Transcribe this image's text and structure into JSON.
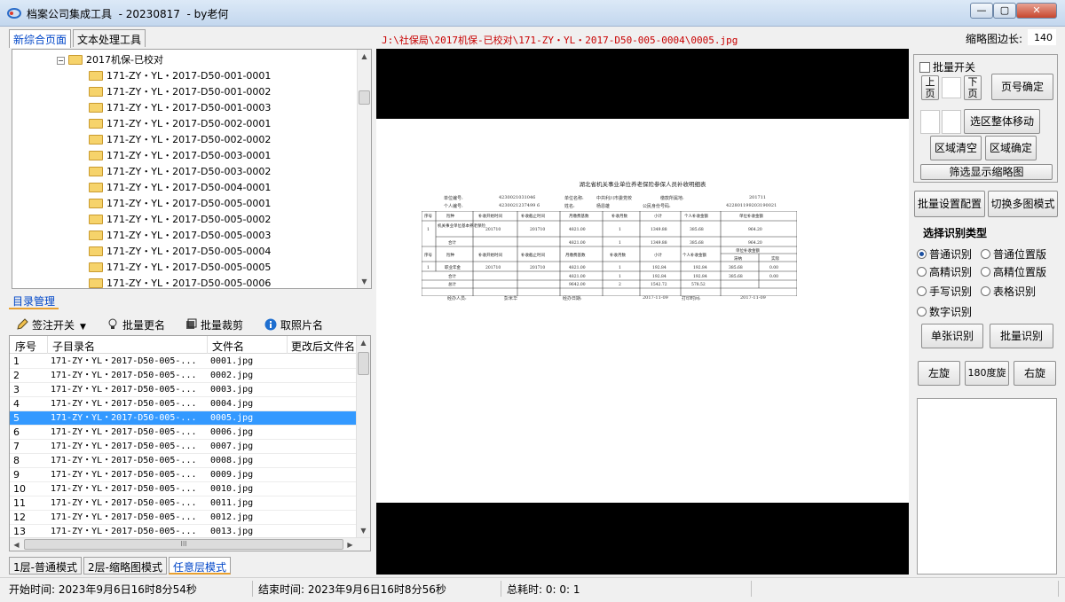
{
  "window": {
    "title": "档案公司集成工具  - 20230817  - by老何",
    "controls": {
      "minimize": "—",
      "maximize": "▢",
      "close": "✕"
    }
  },
  "tabs": [
    {
      "label": "新综合页面",
      "active": true
    },
    {
      "label": "文本处理工具",
      "active": false
    }
  ],
  "current_path": "J:\\社保局\\2017机保-已校对\\171-ZY・YL・2017-D50-005-0004\\0005.jpg",
  "thumbnail_edge": {
    "label": "缩略图边长:",
    "value": "140"
  },
  "tree": {
    "root": "2017机保-已校对",
    "items": [
      "171-ZY・YL・2017-D50-001-0001",
      "171-ZY・YL・2017-D50-001-0002",
      "171-ZY・YL・2017-D50-001-0003",
      "171-ZY・YL・2017-D50-002-0001",
      "171-ZY・YL・2017-D50-002-0002",
      "171-ZY・YL・2017-D50-003-0001",
      "171-ZY・YL・2017-D50-003-0002",
      "171-ZY・YL・2017-D50-004-0001",
      "171-ZY・YL・2017-D50-005-0001",
      "171-ZY・YL・2017-D50-005-0002",
      "171-ZY・YL・2017-D50-005-0003",
      "171-ZY・YL・2017-D50-005-0004",
      "171-ZY・YL・2017-D50-005-0005",
      "171-ZY・YL・2017-D50-005-0006"
    ]
  },
  "dir_mgmt_tab": "目录管理",
  "toolbar": {
    "annotate": "签注开关",
    "batch_rename": "批量更名",
    "batch_crop": "批量裁剪",
    "photo_name": "取照片名"
  },
  "grid": {
    "headers": [
      "序号",
      "子目录名",
      "文件名",
      "更改后文件名"
    ],
    "rows": [
      {
        "no": "1",
        "sub": "171-ZY・YL・2017-D50-005-...",
        "file": "0001.jpg"
      },
      {
        "no": "2",
        "sub": "171-ZY・YL・2017-D50-005-...",
        "file": "0002.jpg"
      },
      {
        "no": "3",
        "sub": "171-ZY・YL・2017-D50-005-...",
        "file": "0003.jpg"
      },
      {
        "no": "4",
        "sub": "171-ZY・YL・2017-D50-005-...",
        "file": "0004.jpg"
      },
      {
        "no": "5",
        "sub": "171-ZY・YL・2017-D50-005-...",
        "file": "0005.jpg"
      },
      {
        "no": "6",
        "sub": "171-ZY・YL・2017-D50-005-...",
        "file": "0006.jpg"
      },
      {
        "no": "7",
        "sub": "171-ZY・YL・2017-D50-005-...",
        "file": "0007.jpg"
      },
      {
        "no": "8",
        "sub": "171-ZY・YL・2017-D50-005-...",
        "file": "0008.jpg"
      },
      {
        "no": "9",
        "sub": "171-ZY・YL・2017-D50-005-...",
        "file": "0009.jpg"
      },
      {
        "no": "10",
        "sub": "171-ZY・YL・2017-D50-005-...",
        "file": "0010.jpg"
      },
      {
        "no": "11",
        "sub": "171-ZY・YL・2017-D50-005-...",
        "file": "0011.jpg"
      },
      {
        "no": "12",
        "sub": "171-ZY・YL・2017-D50-005-...",
        "file": "0012.jpg"
      },
      {
        "no": "13",
        "sub": "171-ZY・YL・2017-D50-005-...",
        "file": "0013.jpg"
      }
    ],
    "selected_no": "5",
    "hscroll_grip": "III"
  },
  "bottom_tabs": [
    "1层-普通模式",
    "2层-缩略图模式",
    "任意层模式"
  ],
  "document": {
    "title": "湖北省机关事业单位养老保险参保人员补收明细表",
    "meta1": [
      "单位编号:",
      "4230021031046",
      "单位名称:",
      "中共利川市委党校",
      "缴款所属地:",
      "201711"
    ],
    "meta2": [
      "个人编号:",
      "4230021237499 6",
      "姓名:",
      "杨恩雄",
      "公民身份号码:",
      "422801199203190021"
    ],
    "table": {
      "h1": [
        "序号",
        "险种",
        "补收开始时间",
        "补收截止时间",
        "月缴费基数",
        "补收月数",
        "小计",
        "个人补收金额",
        "单位补收金额"
      ],
      "r1": [
        "1",
        "机关事业单位基本养老保险",
        "201710",
        "201710",
        "4821.00",
        "1",
        "1349.88",
        "385.68",
        "964.20"
      ],
      "r2": [
        "",
        "",
        "",
        "",
        "4821.00",
        "1",
        "1349.88",
        "385.68",
        "964.20"
      ],
      "r1_label2": "合计",
      "h2": [
        "序号",
        "险种",
        "补收开始时间",
        "补收截止时间",
        "月缴费基数",
        "补收月数",
        "小计",
        "个人补收金额",
        "单位补收金额",
        "滞纳",
        "实际"
      ],
      "r3": [
        "1",
        "职业年金",
        "201710",
        "201710",
        "4821.00",
        "1",
        "192.84",
        "192.84",
        "385.68",
        "0.00"
      ],
      "r4": [
        "合计",
        "4821.00",
        "1",
        "192.84",
        "192.84",
        "385.68",
        "0.00"
      ],
      "r5": [
        "总计",
        "9642.00",
        "2",
        "1542.72",
        "578.52"
      ]
    },
    "footer": [
      "经办人员:",
      "彭米华",
      "经办日期:",
      "2017-11-09",
      "打印时间:",
      "2017-11-09"
    ]
  },
  "right_panel": {
    "batch_switch": "批量开关",
    "prev_page": "上\n页",
    "next_page": "下\n页",
    "page_confirm": "页号确定",
    "move_region": "选区整体移动",
    "clear_region": "区域清空",
    "confirm_region": "区域确定",
    "filter_thumbs": "筛选显示缩略图",
    "batch_config": "批量设置配置",
    "switch_multi": "切换多图模式",
    "ocr_type_title": "选择识别类型",
    "ocr_types": [
      {
        "label": "普通识别",
        "on": true
      },
      {
        "label": "普通位置版",
        "on": false
      },
      {
        "label": "高精识别",
        "on": false
      },
      {
        "label": "高精位置版",
        "on": false
      },
      {
        "label": "手写识别",
        "on": false
      },
      {
        "label": "表格识别",
        "on": false
      },
      {
        "label": "数字识别",
        "on": false
      }
    ],
    "single_ocr": "单张识别",
    "batch_ocr": "批量识别",
    "rotate_left": "左旋",
    "rotate_180": "180度旋",
    "rotate_right": "右旋"
  },
  "status": {
    "start": "开始时间: 2023年9月6日16时8分54秒",
    "end": "结束时间: 2023年9月6日16时8分56秒",
    "total": "总耗时: 0: 0: 1"
  }
}
